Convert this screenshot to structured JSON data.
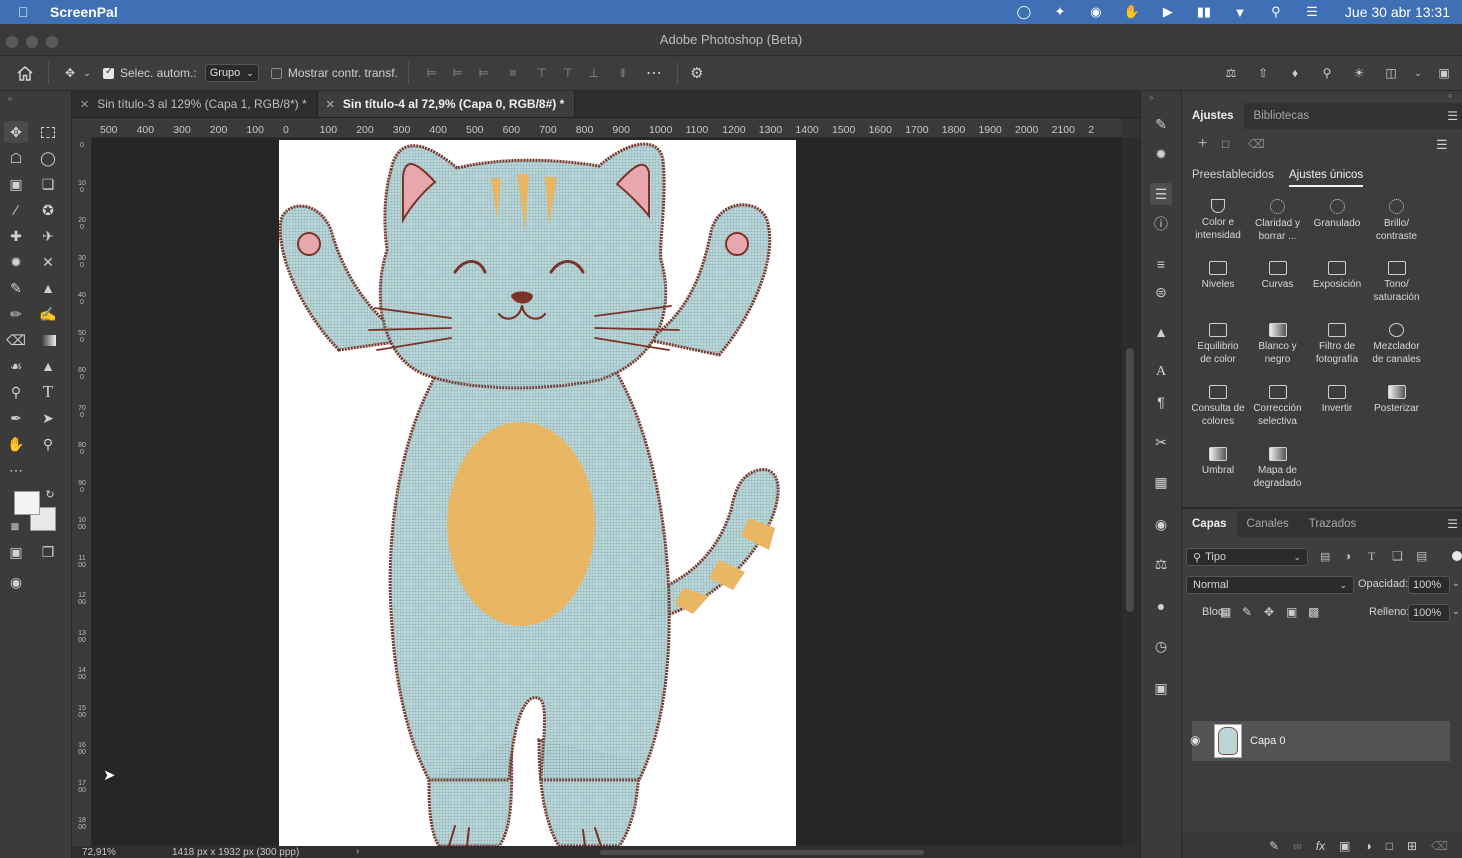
{
  "menubar": {
    "app_name": "ScreenPal",
    "clock": "Jue 30 abr 13:31"
  },
  "window": {
    "title": "Adobe Photoshop (Beta)"
  },
  "options": {
    "auto_select_label": "Selec. autom.:",
    "auto_select_checked": true,
    "auto_select_value": "Grupo",
    "show_transform_label": "Mostrar contr. transf.",
    "show_transform_checked": false
  },
  "tabs": [
    {
      "label": "Sin título-3 al 129% (Capa 1, RGB/8*) *",
      "active": false
    },
    {
      "label": "Sin título-4 al 72,9% (Capa 0, RGB/8#) *",
      "active": true
    }
  ],
  "ruler": {
    "h_ticks": [
      "500",
      "400",
      "300",
      "200",
      "100",
      "0",
      "100",
      "200",
      "300",
      "400",
      "500",
      "600",
      "700",
      "800",
      "900",
      "1000",
      "1100",
      "1200",
      "1300",
      "1400",
      "1500",
      "1600",
      "1700",
      "1800",
      "1900",
      "2000",
      "2100",
      "2"
    ],
    "v_ticks": [
      "0",
      "1 0 0",
      "2 0 0",
      "3 0 0",
      "4 0 0",
      "5 0 0",
      "6 0 0",
      "7 0 0",
      "8 0 0",
      "9 0 0",
      "1 0 0 0",
      "1 1 0 0",
      "1 2 0 0",
      "1 3 0 0",
      "1 4 0 0",
      "1 5 0 0",
      "1 6 0 0",
      "1 7 0 0",
      "1 8 0 0"
    ]
  },
  "status": {
    "zoom": "72,91%",
    "doc_size": "1418 px x 1932 px (300 ppp)",
    "arrow": "›"
  },
  "adjustments": {
    "tabs": [
      "Ajustes",
      "Bibliotecas"
    ],
    "subtabs": [
      "Preestablecidos",
      "Ajustes únicos"
    ],
    "items": [
      "Color e\nintensidad",
      "Claridad y\nborrar ...",
      "Granulado",
      "Brillo/\ncontraste",
      "Niveles",
      "Curvas",
      "Exposición",
      "Tono/\nsaturación",
      "Equilibrio\nde color",
      "Blanco y\nnegro",
      "Filtro de\nfotografía",
      "Mezclador\nde canales",
      "Consulta de\ncolores",
      "Corrección\nselectiva",
      "Invertir",
      "Posterizar",
      "Umbral",
      "Mapa de\ndegradado"
    ]
  },
  "layers": {
    "tabs": [
      "Capas",
      "Canales",
      "Trazados"
    ],
    "filter": "Tipo",
    "blend_mode": "Normal",
    "opacity_label": "Opacidad:",
    "opacity_value": "100%",
    "lock_label": "Bloq.:",
    "fill_label": "Relleno:",
    "fill_value": "100%",
    "layer_name": "Capa 0"
  },
  "colors": {
    "menubar": "#3f6fb4",
    "cat_body": "#b9d5d8",
    "cat_outline": "#7a3326",
    "cat_belly": "#e9b763",
    "cat_ears": "#e6a8ae"
  }
}
